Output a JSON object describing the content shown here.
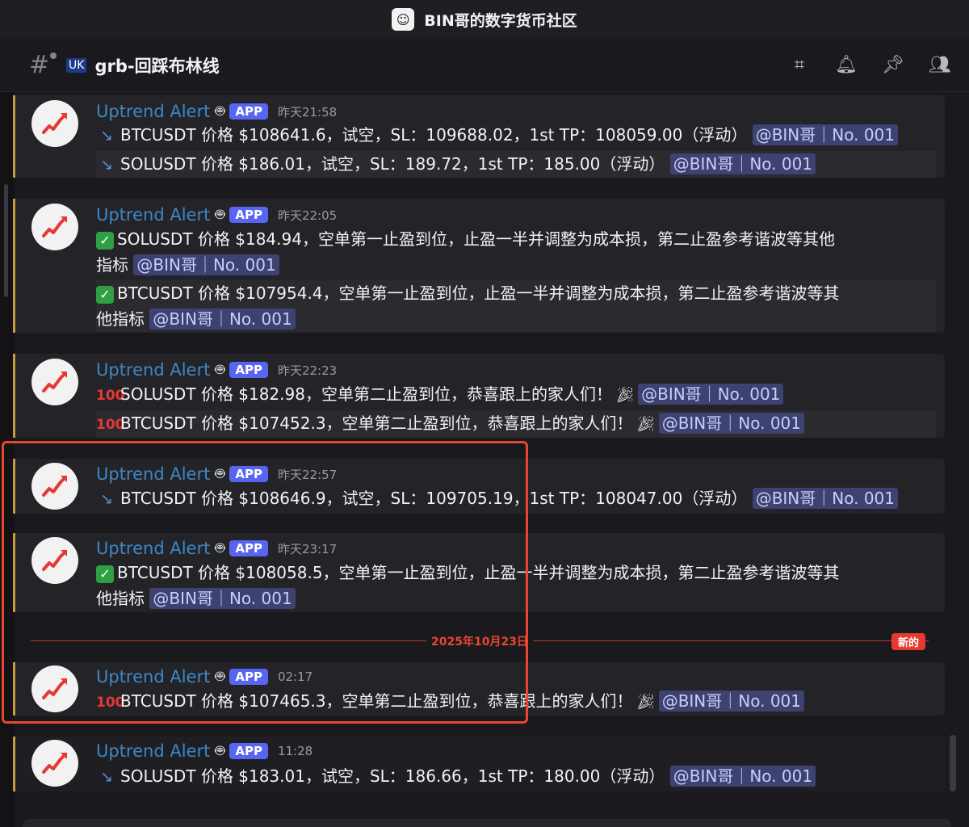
{
  "server": {
    "name": "BIN哥的数字货币社区",
    "icon": "avatar-sketch-icon"
  },
  "channel": {
    "name": "grb-回踩布林线",
    "flag": "🇬🇧",
    "header_icons": [
      "threads-icon",
      "bell-icon",
      "pin-icon",
      "members-icon"
    ]
  },
  "app_tag": "APP",
  "author": "Uptrend Alert",
  "mention": "@BIN哥｜No. 001",
  "divider": {
    "date": "2025年10月23日",
    "new_label": "新的"
  },
  "messages": [
    {
      "time": "昨天21:58",
      "lines": [
        {
          "icon": "chart-down-icon",
          "text": "BTCUSDT 价格 $108641.6，试空，SL：109688.02，1st TP：108059.00（浮动）"
        },
        {
          "icon": "chart-down-icon",
          "text": "SOLUSDT 价格 $186.01，试空，SL：189.72，1st TP：185.00（浮动）"
        }
      ]
    },
    {
      "time": "昨天22:05",
      "lines": [
        {
          "icon": "check-icon",
          "text": "SOLUSDT 价格 $184.94，空单第一止盈到位，止盈一半并调整为成本损，第二止盈参考谐波等其他",
          "text2": "指标"
        },
        {
          "icon": "check-icon",
          "text": "BTCUSDT 价格 $107954.4，空单第一止盈到位，止盈一半并调整为成本损，第二止盈参考谐波等其",
          "text2": "他指标"
        }
      ]
    },
    {
      "time": "昨天22:23",
      "lines": [
        {
          "icon": "hundred-icon",
          "text": "SOLUSDT 价格 $182.98，空单第二止盈到位，恭喜跟上的家人们！"
        },
        {
          "icon": "hundred-icon",
          "text": "BTCUSDT 价格 $107452.3，空单第二止盈到位，恭喜跟上的家人们！"
        }
      ]
    },
    {
      "time": "昨天22:57",
      "lines": [
        {
          "icon": "chart-down-icon",
          "text": "BTCUSDT 价格 $108646.9，试空，SL：109705.19，1st TP：108047.00（浮动）"
        }
      ]
    },
    {
      "time": "昨天23:17",
      "lines": [
        {
          "icon": "check-icon",
          "text": "BTCUSDT 价格 $108058.5，空单第一止盈到位，止盈一半并调整为成本损，第二止盈参考谐波等其",
          "text2": "他指标"
        }
      ]
    },
    {
      "time": "02:17",
      "lines": [
        {
          "icon": "hundred-icon",
          "text": "BTCUSDT 价格 $107465.3，空单第二止盈到位，恭喜跟上的家人们！"
        }
      ]
    },
    {
      "time": "11:28",
      "lines": [
        {
          "icon": "chart-down-icon",
          "text": "SOLUSDT 价格 $183.01，试空，SL：186.66，1st TP：180.00（浮动）"
        }
      ]
    }
  ]
}
